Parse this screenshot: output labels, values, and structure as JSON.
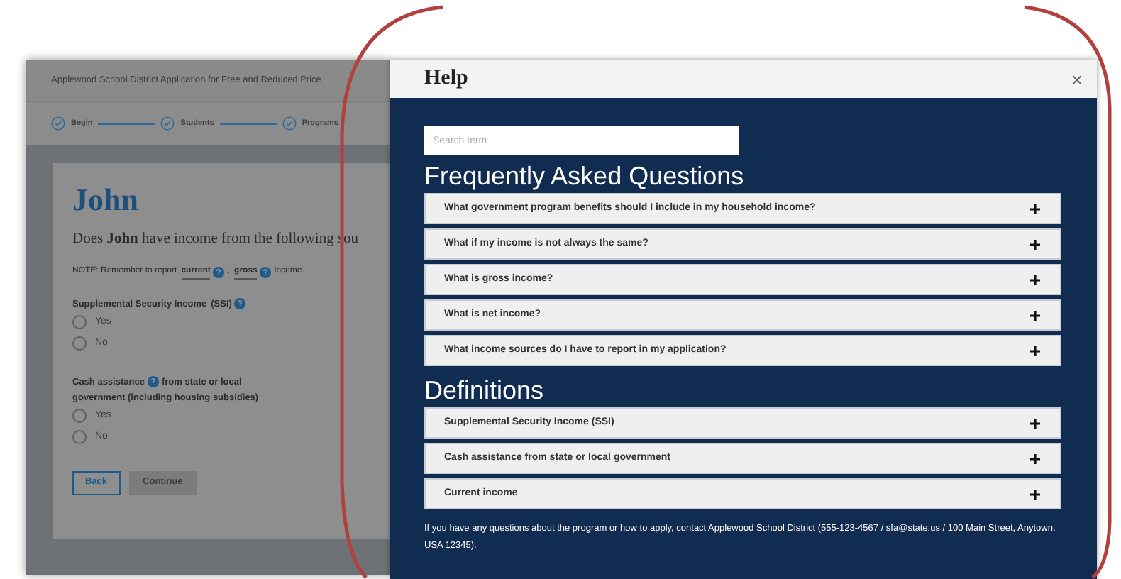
{
  "page": {
    "title": "Applewood School District Application for Free and Reduced Price",
    "steps": [
      {
        "label": "Begin"
      },
      {
        "label": "Students"
      },
      {
        "label": "Programs"
      }
    ],
    "heading": "John",
    "question": "Does **John** have income from the following sou",
    "note": {
      "prefix": "NOTE: Remember to report",
      "link1": "current",
      "separator": ",",
      "link2": "gross",
      "suffix": "income."
    },
    "fields": [
      {
        "label": "Supplemental Security Income",
        "term": "(SSI)",
        "options": [
          {
            "label": "Yes",
            "selected": false
          },
          {
            "label": "No",
            "selected": false
          }
        ]
      },
      {
        "label": "Cash assistance",
        "label_after": "from state or local",
        "label_line2": "government (including housing subsidies)",
        "options": [
          {
            "label": "Yes",
            "selected": false
          },
          {
            "label": "No",
            "selected": false
          }
        ]
      }
    ],
    "buttons": [
      {
        "label": "Back",
        "kind": "outline"
      },
      {
        "label": "Continue",
        "kind": "filled"
      }
    ]
  },
  "dialog": {
    "title": "Help",
    "close": "×",
    "search": {
      "placeholder": "Search term"
    },
    "sections": [
      {
        "title": "Frequently Asked Questions",
        "items": [
          {
            "label": "What government program benefits should I include in my household income?",
            "expanded": false
          },
          {
            "label": "What if my income is not always the same?",
            "expanded": false
          },
          {
            "label": "What is gross income?",
            "expanded": false
          },
          {
            "label": "What is net income?",
            "expanded": false
          },
          {
            "label": "What income sources do I have to report in my application?",
            "expanded": false
          }
        ]
      },
      {
        "title": "Definitions",
        "items": [
          {
            "label": "Supplemental Security Income (SSI)",
            "expanded": false
          },
          {
            "label": "Cash assistance from state or local government",
            "expanded": false
          },
          {
            "label": "Current income",
            "expanded": false
          }
        ]
      }
    ],
    "footer": "If you have any questions about the program or how to apply, contact Applewood School District (555-123-4567 / sfa@state.us / 100 Main Street, Anytown, USA 12345)."
  }
}
